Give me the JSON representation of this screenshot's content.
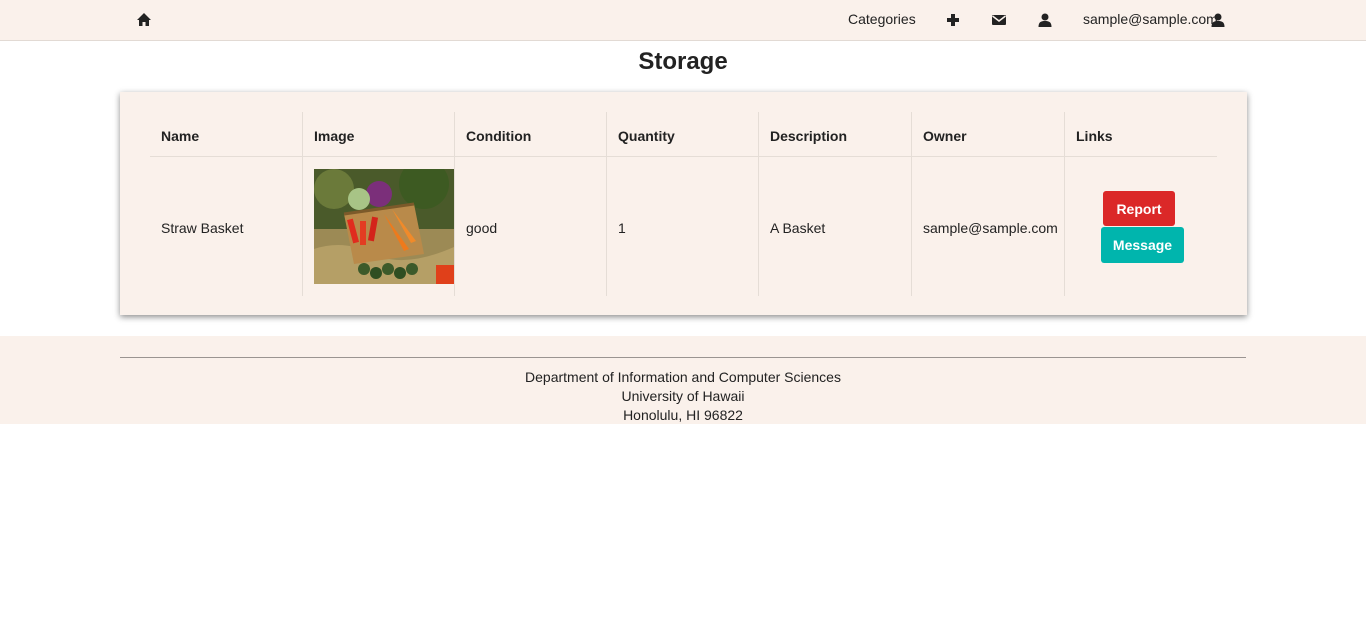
{
  "nav": {
    "categories_label": "Categories",
    "user_email": "sample@sample.com"
  },
  "page": {
    "title": "Storage"
  },
  "table": {
    "headers": [
      "Name",
      "Image",
      "Condition",
      "Quantity",
      "Description",
      "Owner",
      "Links"
    ],
    "rows": [
      {
        "name": "Straw Basket",
        "condition": "good",
        "quantity": "1",
        "description": "A Basket",
        "owner": "sample@sample.com",
        "report_label": "Report",
        "message_label": "Message"
      }
    ]
  },
  "footer": {
    "line1": "Department of Information and Computer Sciences",
    "line2": "University of Hawaii",
    "line3": "Honolulu, HI 96822"
  },
  "colors": {
    "beige_bg": "#faf1eb",
    "report_red": "#db2828",
    "message_teal": "#00b5ad"
  },
  "icons": [
    "home-icon",
    "plus-icon",
    "envelope-icon",
    "user-icon"
  ]
}
